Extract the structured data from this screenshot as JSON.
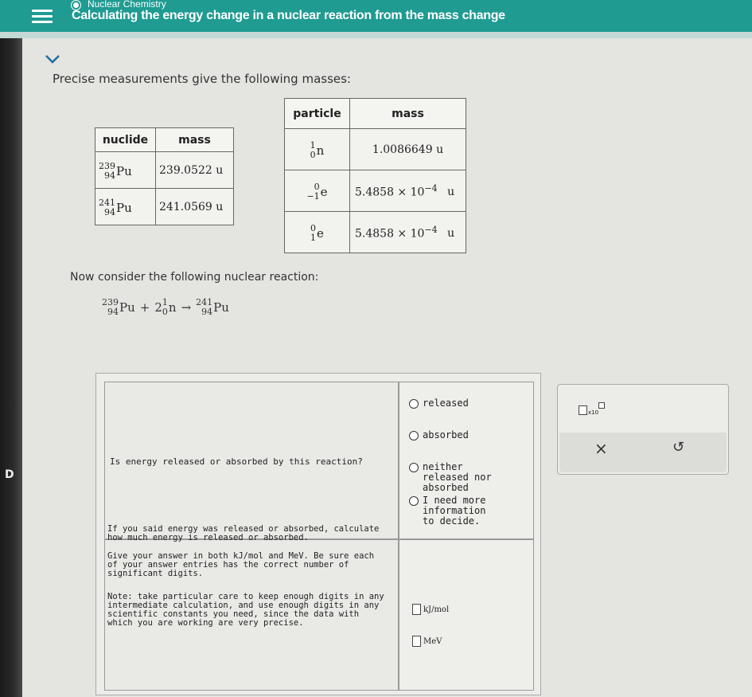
{
  "header": {
    "topic": "Nuclear Chemistry",
    "title": "Calculating the energy change in a nuclear reaction from the mass change"
  },
  "intro": "Precise measurements give the following masses:",
  "nuclide_table": {
    "headers": [
      "nuclide",
      "mass"
    ],
    "rows": [
      {
        "mass_num": "239",
        "atomic_num": "94",
        "symbol": "Pu",
        "mass": "239.0522 u"
      },
      {
        "mass_num": "241",
        "atomic_num": "94",
        "symbol": "Pu",
        "mass": "241.0569 u"
      }
    ]
  },
  "particle_table": {
    "headers": [
      "particle",
      "mass"
    ],
    "rows": [
      {
        "top": "1",
        "bottom": "0",
        "symbol": "n",
        "mass_text": "1.0086649 u",
        "mantissa": "",
        "exponent": "",
        "unit": ""
      },
      {
        "top": "0",
        "bottom": "−1",
        "symbol": "e",
        "mass_text": "",
        "mantissa": "5.4858 × 10",
        "exponent": "−4",
        "unit": "u"
      },
      {
        "top": "0",
        "bottom": "1",
        "symbol": "e",
        "mass_text": "",
        "mantissa": "5.4858 × 10",
        "exponent": "−4",
        "unit": "u"
      }
    ]
  },
  "consider": "Now consider the following nuclear reaction:",
  "reaction": {
    "r1": {
      "top": "239",
      "bottom": "94",
      "symbol": "Pu"
    },
    "plus": "+",
    "coef": "2",
    "r2": {
      "top": "1",
      "bottom": "0",
      "symbol": "n"
    },
    "arrow": "→",
    "p1": {
      "top": "241",
      "bottom": "94",
      "symbol": "Pu"
    }
  },
  "question1": "Is energy released or absorbed by this reaction?",
  "options": [
    "released",
    "absorbed",
    "neither released nor absorbed",
    "I need more information to decide."
  ],
  "question2": {
    "p1": "If you said energy was released or absorbed, calculate how much energy is released or absorbed.",
    "p2": "Give your answer in both kJ/mol and MeV. Be sure each of your answer entries has the correct number of significant digits.",
    "p3": "Note: take particular care to keep enough digits in any intermediate calculation, and use enough digits in any scientific constants you need, since the data with which you are working are very precise."
  },
  "units": [
    "kJ/mol",
    "MeV"
  ],
  "tools": {
    "x10_label": "x10",
    "clear": "×",
    "undo": "↺"
  },
  "bezel_letter": "D"
}
